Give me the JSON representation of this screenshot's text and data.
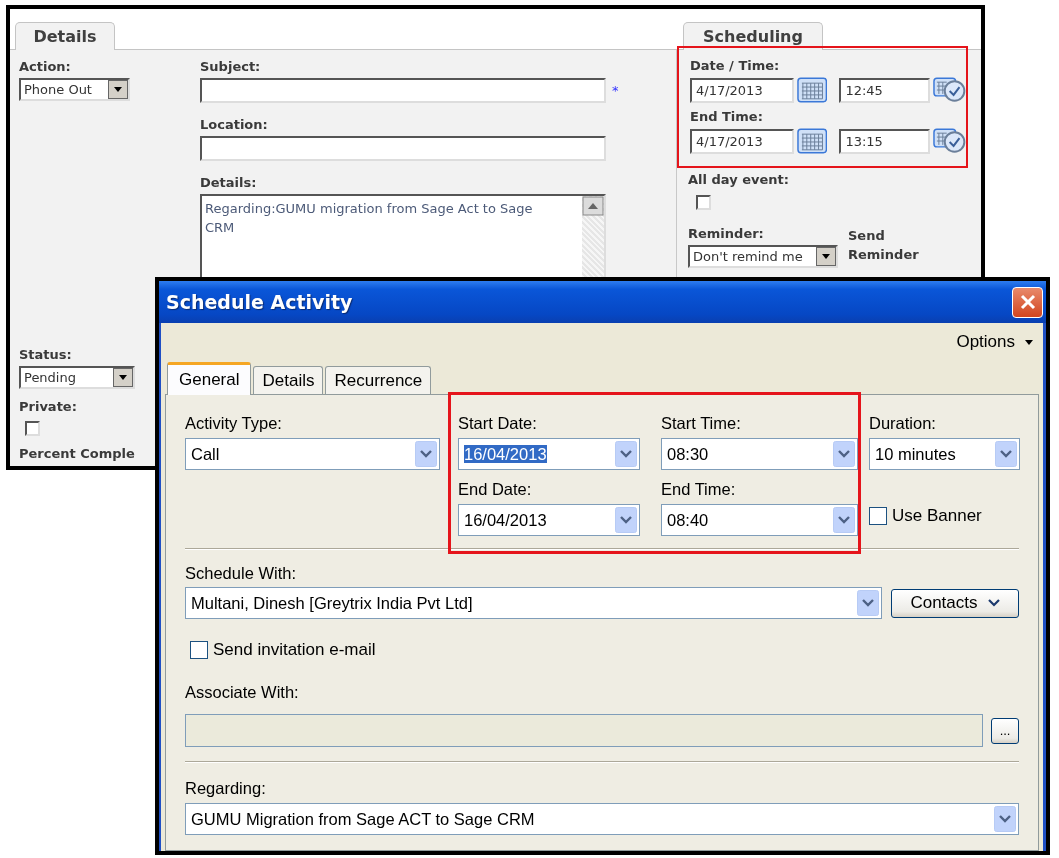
{
  "background_form": {
    "details_tab": "Details",
    "scheduling_tab": "Scheduling",
    "action": {
      "label": "Action:",
      "value": "Phone Out"
    },
    "status": {
      "label": "Status:",
      "value": "Pending"
    },
    "private": {
      "label": "Private:",
      "checked": false
    },
    "percent_complete": {
      "label": "Percent Comple"
    },
    "subject": {
      "label": "Subject:",
      "required_mark": "*"
    },
    "location": {
      "label": "Location:"
    },
    "details": {
      "label": "Details:",
      "value": "Regarding:GUMU migration from Sage Act to Sage CRM"
    },
    "date_time": {
      "label": "Date / Time:",
      "date": "4/17/2013",
      "time": "12:45"
    },
    "end_time": {
      "label": "End Time:",
      "date": "4/17/2013",
      "time": "13:15"
    },
    "all_day_event": {
      "label": "All day event:",
      "checked": false
    },
    "reminder": {
      "label": "Reminder:",
      "value": "Don't remind me"
    },
    "send_reminder": {
      "label": "Send Reminder"
    }
  },
  "dialog": {
    "title": "Schedule Activity",
    "options": "Options",
    "tabs": [
      {
        "label": "General",
        "selected": true
      },
      {
        "label": "Details",
        "selected": false
      },
      {
        "label": "Recurrence",
        "selected": false
      }
    ],
    "activity_type": {
      "label": "Activity Type:",
      "value": "Call"
    },
    "start_date": {
      "label": "Start Date:",
      "value": "16/04/2013",
      "highlighted": true
    },
    "start_time": {
      "label": "Start Time:",
      "value": "08:30"
    },
    "duration": {
      "label": "Duration:",
      "value": "10 minutes"
    },
    "end_date": {
      "label": "End Date:",
      "value": "16/04/2013",
      "highlighted": false
    },
    "end_time": {
      "label": "End Time:",
      "value": "08:40"
    },
    "use_banner": {
      "label": "Use Banner",
      "checked": false
    },
    "schedule_with": {
      "label": "Schedule With:",
      "value": "Multani, Dinesh [Greytrix India Pvt Ltd]"
    },
    "contacts_button": "Contacts",
    "send_invitation": {
      "label": "Send invitation e-mail",
      "checked": false
    },
    "associate_with": {
      "label": "Associate With:",
      "disabled": true
    },
    "browse_button": "...",
    "regarding": {
      "label": "Regarding:",
      "value": "GUMU Migration from Sage ACT to Sage CRM"
    }
  }
}
